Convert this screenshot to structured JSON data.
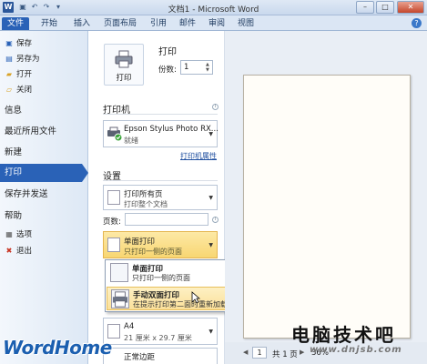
{
  "window": {
    "title": "文档1 - Microsoft Word",
    "app_icon": "W",
    "controls": [
      "–",
      "□",
      "✕"
    ]
  },
  "ribbon": {
    "tabs": [
      "文件",
      "开始",
      "插入",
      "页面布局",
      "引用",
      "邮件",
      "审阅",
      "视图"
    ]
  },
  "nav": {
    "small_items": [
      {
        "label": "保存",
        "icon": "save-icon"
      },
      {
        "label": "另存为",
        "icon": "save-as-icon"
      },
      {
        "label": "打开",
        "icon": "open-folder-icon"
      },
      {
        "label": "关闭",
        "icon": "close-folder-icon"
      }
    ],
    "big_items": [
      "信息",
      "最近所用文件",
      "新建",
      "打印",
      "保存并发送",
      "帮助"
    ],
    "active": "打印",
    "footer_items": [
      {
        "label": "选项",
        "icon": "options-icon"
      },
      {
        "label": "退出",
        "icon": "exit-icon"
      }
    ]
  },
  "print": {
    "section_title": "打印",
    "button_label": "打印",
    "copies_label": "份数:",
    "copies_value": "1",
    "printer_title": "打印机",
    "printer_name": "Epson Stylus Photo RX...",
    "printer_status": "就绪",
    "printer_props_link": "打印机属性",
    "settings_title": "设置",
    "print_all_main": "打印所有页",
    "print_all_sub": "打印整个文档",
    "pages_label": "页数:",
    "duplex_main": "单面打印",
    "duplex_sub": "只打印一侧的页面",
    "paper_main": "A4",
    "paper_sub": "21 厘米 x 29.7 厘米",
    "margins_main": "正常边距"
  },
  "popup": {
    "items": [
      {
        "main": "单面打印",
        "sub": "只打印一侧的页面"
      },
      {
        "main": "手动双面打印",
        "sub": "在提示打印第二面时重新加载纸张"
      }
    ],
    "selected_index": 1
  },
  "preview": {
    "page_input": "1",
    "page_total": "共 1 页",
    "zoom": "36%"
  },
  "watermarks": {
    "left": "WordHome",
    "right_top": "电脑技术吧",
    "right_bottom": "www.dnjsb.com"
  },
  "colors": {
    "accent": "#2a62b7",
    "highlight": "#f8d672"
  }
}
